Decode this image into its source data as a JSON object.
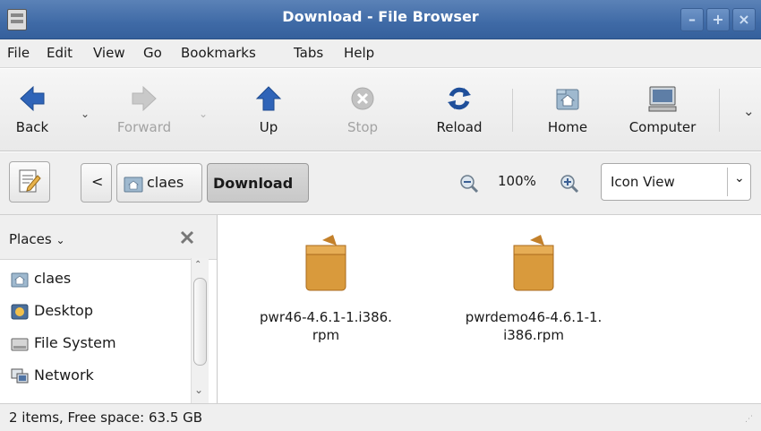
{
  "window": {
    "title": "Download - File Browser",
    "minimize_label": "–",
    "maximize_label": "+",
    "close_label": "×"
  },
  "menu": [
    "File",
    "Edit",
    "View",
    "Go",
    "Bookmarks",
    "Tabs",
    "Help"
  ],
  "toolbar": {
    "back": "Back",
    "forward": "Forward",
    "up": "Up",
    "stop": "Stop",
    "reload": "Reload",
    "home": "Home",
    "computer": "Computer"
  },
  "location": {
    "crumbs": [
      "claes",
      "Download"
    ],
    "zoom": "100%",
    "view_mode": "Icon View"
  },
  "sidebar": {
    "header": "Places",
    "items": [
      {
        "label": "claes",
        "icon": "home-folder-icon"
      },
      {
        "label": "Desktop",
        "icon": "desktop-icon"
      },
      {
        "label": "File System",
        "icon": "drive-icon"
      },
      {
        "label": "Network",
        "icon": "network-icon"
      }
    ]
  },
  "files": [
    {
      "line1": "pwr46-4.6.1-1.i386.",
      "line2": "rpm",
      "icon": "package-icon"
    },
    {
      "line1": "pwrdemo46-4.6.1-1.",
      "line2": "i386.rpm",
      "icon": "package-icon"
    }
  ],
  "status": {
    "text": "2 items, Free space: 63.5 GB"
  },
  "colors": {
    "titlebar": "#4a74ad",
    "accent": "#3a6bb0",
    "package": "#d99a3c"
  }
}
